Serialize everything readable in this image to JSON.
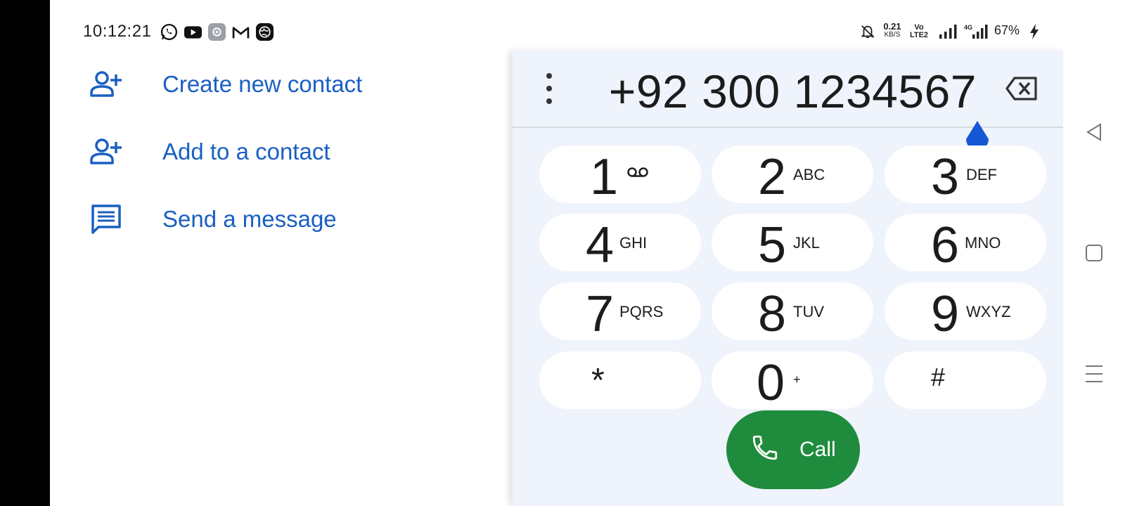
{
  "status_bar": {
    "time": "10:12:21",
    "app_icons": [
      "whatsapp-icon",
      "youtube-icon",
      "settings-app-icon",
      "gmail-icon",
      "globe-app-icon"
    ],
    "net_speed_value": "0.21",
    "net_speed_unit": "KB/S",
    "volte_top": "Vo",
    "volte_bottom": "LTE2",
    "network_type": "4G",
    "battery": "67%"
  },
  "actions": [
    {
      "label": "Create new contact",
      "icon": "person-add-icon"
    },
    {
      "label": "Add to a contact",
      "icon": "person-add-icon"
    },
    {
      "label": "Send a message",
      "icon": "message-icon"
    }
  ],
  "dialer": {
    "number": "+92 300 1234567",
    "keys": [
      {
        "digit": "1",
        "letters": ""
      },
      {
        "digit": "2",
        "letters": "ABC"
      },
      {
        "digit": "3",
        "letters": "DEF"
      },
      {
        "digit": "4",
        "letters": "GHI"
      },
      {
        "digit": "5",
        "letters": "JKL"
      },
      {
        "digit": "6",
        "letters": "MNO"
      },
      {
        "digit": "7",
        "letters": "PQRS"
      },
      {
        "digit": "8",
        "letters": "TUV"
      },
      {
        "digit": "9",
        "letters": "WXYZ"
      },
      {
        "digit": "*",
        "letters": ""
      },
      {
        "digit": "0",
        "letters": "+"
      },
      {
        "digit": "#",
        "letters": ""
      }
    ],
    "call_label": "Call"
  },
  "colors": {
    "accent": "#1a5fc2",
    "call": "#1f8b3c",
    "dialer_bg": "#eff3fb"
  }
}
